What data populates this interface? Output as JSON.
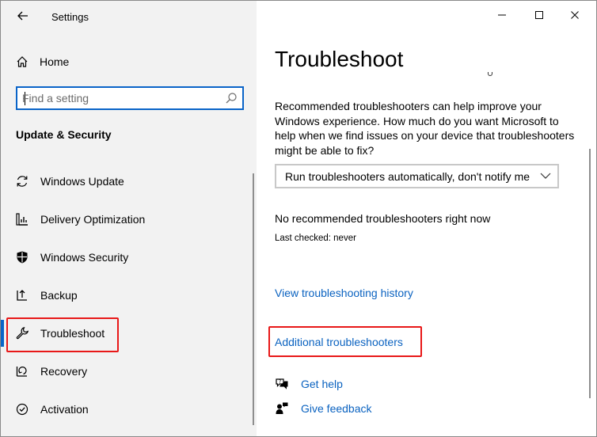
{
  "window": {
    "title": "Settings"
  },
  "sidebar": {
    "home_label": "Home",
    "search": {
      "placeholder": "Find a setting",
      "value": ""
    },
    "section_title": "Update & Security",
    "items": [
      {
        "label": "Windows Update",
        "icon": "sync-icon"
      },
      {
        "label": "Delivery Optimization",
        "icon": "delivery-optimization-icon"
      },
      {
        "label": "Windows Security",
        "icon": "shield-icon"
      },
      {
        "label": "Backup",
        "icon": "backup-icon"
      },
      {
        "label": "Troubleshoot",
        "icon": "wrench-icon",
        "active": true
      },
      {
        "label": "Recovery",
        "icon": "recovery-icon"
      },
      {
        "label": "Activation",
        "icon": "activation-icon"
      }
    ]
  },
  "content": {
    "title": "Troubleshoot",
    "description": "Recommended troubleshooters can help improve your Windows experience. How much do you want Microsoft to help when we find issues on your device that troubleshooters might be able to fix?",
    "dropdown_value": "Run troubleshooters automatically, don't notify me",
    "no_recommended": "No recommended troubleshooters right now",
    "last_checked": "Last checked: never",
    "history_link": "View troubleshooting history",
    "additional_link": "Additional troubleshooters",
    "get_help": "Get help",
    "give_feedback": "Give feedback"
  },
  "colors": {
    "accent": "#0a64c8",
    "highlight_box": "#e81818",
    "sidebar_bg": "#f2f2f2",
    "link": "#0a62c0"
  }
}
